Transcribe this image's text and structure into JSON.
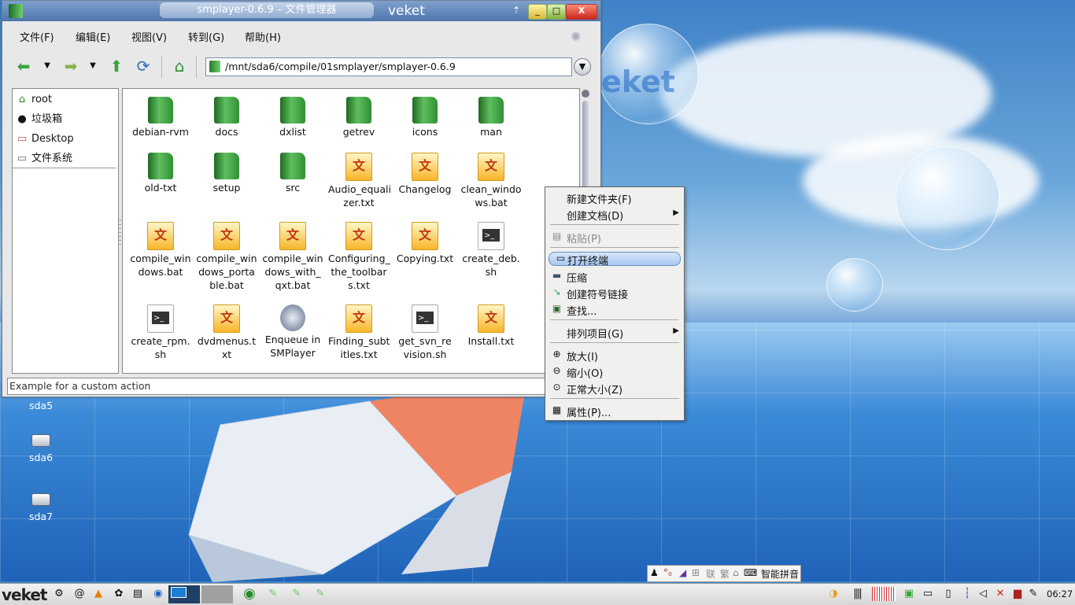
{
  "window": {
    "title": "smplayer-0.6.9 – 文件管理器",
    "wm_brand": "veket",
    "minimize": "_",
    "maximize": "□",
    "close": "X"
  },
  "menu": [
    "文件(F)",
    "编辑(E)",
    "视图(V)",
    "转到(G)",
    "帮助(H)"
  ],
  "address": {
    "path": "/mnt/sda6/compile/01smplayer/smplayer-0.6.9"
  },
  "sidebar": [
    {
      "label": "root",
      "icon": "home-icon"
    },
    {
      "label": "垃圾箱",
      "icon": "trash-icon"
    },
    {
      "label": "Desktop",
      "icon": "desktop-icon"
    },
    {
      "label": "文件系统",
      "icon": "drive-icon"
    }
  ],
  "files": [
    {
      "name": "debian-rvm",
      "type": "folder"
    },
    {
      "name": "docs",
      "type": "folder"
    },
    {
      "name": "dxlist",
      "type": "folder"
    },
    {
      "name": "getrev",
      "type": "folder"
    },
    {
      "name": "icons",
      "type": "folder"
    },
    {
      "name": "man",
      "type": "folder"
    },
    {
      "name": "old-txt",
      "type": "folder"
    },
    {
      "name": "setup",
      "type": "folder"
    },
    {
      "name": "src",
      "type": "folder"
    },
    {
      "name": "Audio_equalizer.txt",
      "type": "txt",
      "lines": [
        "Audio_equali",
        "zer.txt"
      ]
    },
    {
      "name": "Changelog",
      "type": "txt"
    },
    {
      "name": "clean_windows.bat",
      "type": "txt",
      "lines": [
        "clean_windo",
        "ws.bat"
      ]
    },
    {
      "name": "compile_windows.bat",
      "type": "txt",
      "lines": [
        "compile_win",
        "dows.bat"
      ]
    },
    {
      "name": "compile_windows_portable.bat",
      "type": "txt",
      "lines": [
        "compile_win",
        "dows_porta",
        "ble.bat"
      ]
    },
    {
      "name": "compile_windows_with_qxt.bat",
      "type": "txt",
      "lines": [
        "compile_win",
        "dows_with_",
        "qxt.bat"
      ]
    },
    {
      "name": "Configuring_the_toolbars.txt",
      "type": "txt",
      "lines": [
        "Configuring_",
        "the_toolbar",
        "s.txt"
      ]
    },
    {
      "name": "Copying.txt",
      "type": "txt"
    },
    {
      "name": "create_deb.sh",
      "type": "sh",
      "lines": [
        "create_deb.",
        "sh"
      ]
    },
    {
      "name": "create_rpm.sh",
      "type": "sh",
      "lines": [
        "create_rpm.",
        "sh"
      ]
    },
    {
      "name": "dvdmenus.txt",
      "type": "txt",
      "lines": [
        "dvdmenus.t",
        "xt"
      ]
    },
    {
      "name": "Enqueue in SMPlayer",
      "type": "bin",
      "lines": [
        "Enqueue in",
        "SMPlayer"
      ]
    },
    {
      "name": "Finding_subtitles.txt",
      "type": "txt",
      "lines": [
        "Finding_subt",
        "itles.txt"
      ]
    },
    {
      "name": "get_svn_revision.sh",
      "type": "sh",
      "lines": [
        "get_svn_re",
        "vision.sh"
      ]
    },
    {
      "name": "Install.txt",
      "type": "txt"
    }
  ],
  "statusbar": "Example for a custom action",
  "context_menu": [
    {
      "label": "新建文件夹(F)",
      "icon": "new-folder-icon"
    },
    {
      "label": "创建文档(D)",
      "icon": "",
      "submenu": true
    },
    {
      "label": "粘贴(P)",
      "icon": "paste-icon",
      "disabled": true
    },
    {
      "label": "打开终端",
      "icon": "terminal-icon",
      "highlighted": true
    },
    {
      "label": "压缩",
      "icon": "compress-icon"
    },
    {
      "label": "创建符号链接",
      "icon": "symlink-icon"
    },
    {
      "label": "查找...",
      "icon": "find-icon"
    },
    {
      "label": "排列项目(G)",
      "icon": "",
      "submenu": true
    },
    {
      "label": "放大(I)",
      "icon": "zoom-in-icon"
    },
    {
      "label": "缩小(O)",
      "icon": "zoom-out-icon"
    },
    {
      "label": "正常大小(Z)",
      "icon": "zoom-normal-icon"
    },
    {
      "label": "属性(P)...",
      "icon": "properties-icon"
    }
  ],
  "desktop": {
    "logo": "veket",
    "icons": [
      "sda5",
      "sda6",
      "sda7"
    ]
  },
  "ime": {
    "label": "智能拼音",
    "symbols": [
      "联",
      "繁"
    ]
  },
  "taskbar": {
    "logo": "veket",
    "clock": "06:27"
  }
}
